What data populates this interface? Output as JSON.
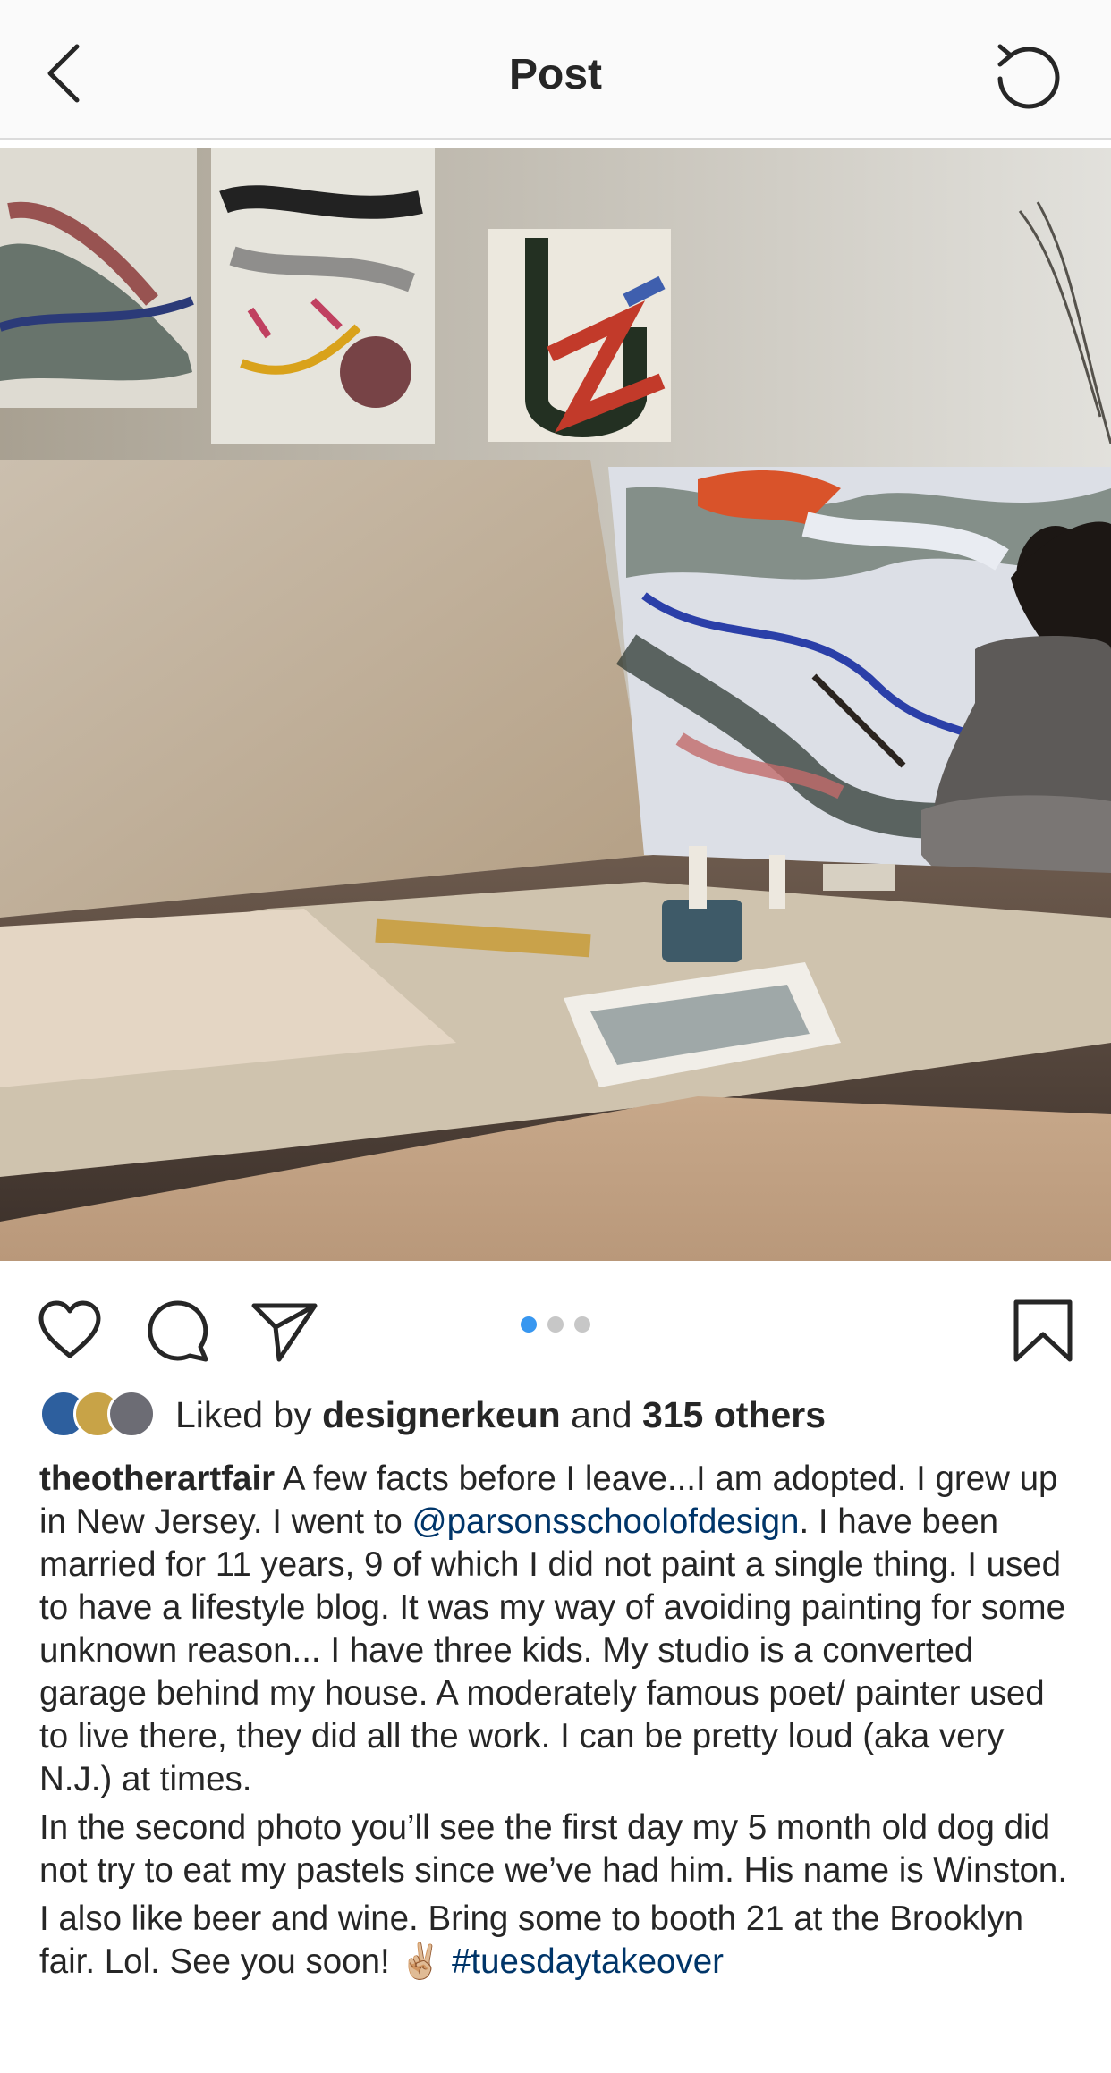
{
  "header": {
    "title": "Post",
    "back_icon": "chevron-left-icon",
    "refresh_icon": "refresh-icon"
  },
  "post": {
    "image_alt": "Artist painting a large abstract canvas in a studio",
    "carousel": {
      "count": 3,
      "active_index": 0
    },
    "actions": {
      "like_icon": "heart-icon",
      "comment_icon": "comment-icon",
      "share_icon": "send-icon",
      "save_icon": "bookmark-icon"
    },
    "likes": {
      "prefix": "Liked by",
      "user": "designerkeun",
      "connector": "and",
      "others": "315 others"
    },
    "caption": {
      "username": "theotherartfair",
      "p1_before_mention": " A few facts before I leave...I am adopted. I grew up in New Jersey. I went to ",
      "mention": "@parsonsschoolofdesign",
      "p1_after_mention": ". I have been married for 11 years, 9 of which I did not paint a single thing. I used to have a lifestyle blog. It was my way of avoiding painting for some unknown reason... I have three kids. My studio is a converted garage behind my house. A moderately famous poet/ painter used to live there, they did all the work. I can be pretty loud (aka very N.J.) at times.",
      "p2": "In the second photo you’ll see the first day my 5 month old dog did not try to eat my pastels since we’ve had him. His name is Winston.",
      "p3_text": "I also like beer and wine. Bring some to booth 21 at the Brooklyn fair. Lol. See you soon! ✌🏼 ",
      "hashtag": "#tuesdaytakeover"
    }
  },
  "colors": {
    "link": "#003569",
    "dot_active": "#3897f0",
    "dot_inactive": "#c7c7c7",
    "text": "#262626"
  }
}
